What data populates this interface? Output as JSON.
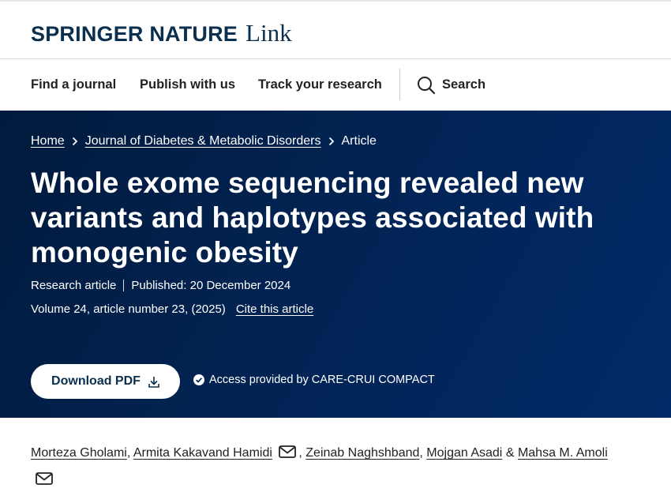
{
  "brand": {
    "name": "SPRINGER NATURE",
    "product": "Link"
  },
  "nav": {
    "items": [
      "Find a journal",
      "Publish with us",
      "Track your research"
    ],
    "search_label": "Search"
  },
  "breadcrumb": {
    "home": "Home",
    "journal": "Journal of Diabetes & Metabolic Disorders",
    "current": "Article"
  },
  "article": {
    "title": "Whole exome sequencing revealed new variants and haplotypes associated with monogenic obesity",
    "type": "Research article",
    "published": "Published: 20 December 2024",
    "volume": "Volume 24, article number 23, (2025)",
    "cite_label": "Cite this article"
  },
  "actions": {
    "download_label": "Download PDF",
    "access_text": "Access provided by CARE-CRUI COMPACT"
  },
  "authors": {
    "list": [
      "Morteza Gholami",
      "Armita Kakavand Hamidi",
      "Zeinab Naghshband",
      "Mojgan Asadi",
      "Mahsa M. Amoli"
    ],
    "separators": [
      ",",
      ",",
      ",",
      "&"
    ]
  },
  "colors": {
    "brand_navy": "#0b2f4e",
    "hero_start": "#011a3c",
    "hero_end": "#012a68"
  }
}
